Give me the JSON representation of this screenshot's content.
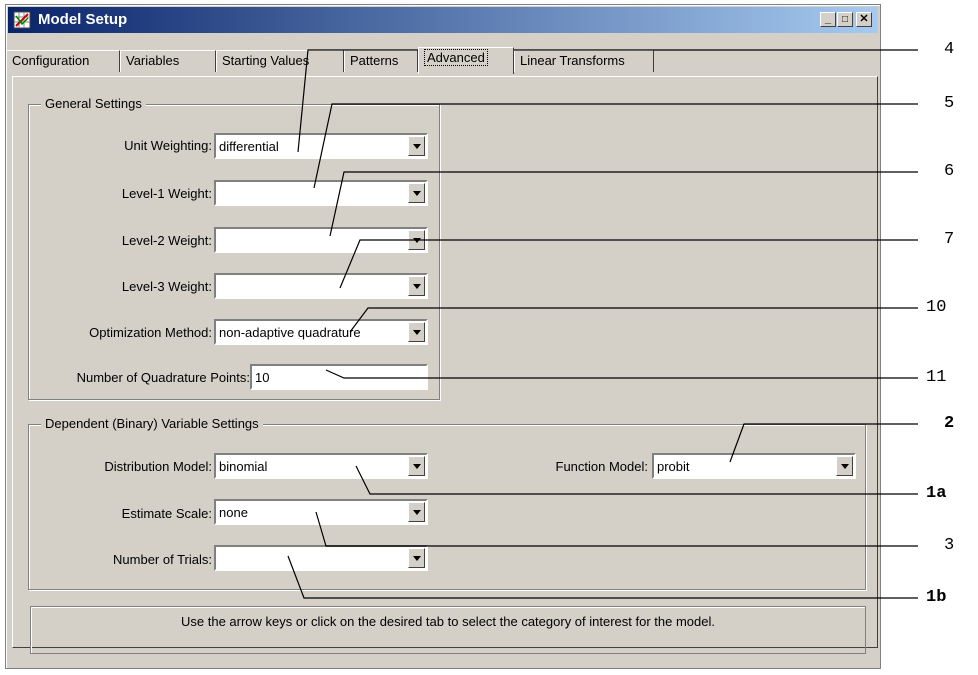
{
  "window": {
    "title": "Model Setup",
    "min": "_",
    "max": "□",
    "close": "✕"
  },
  "tabs": [
    {
      "label": "Configuration",
      "active": false
    },
    {
      "label": "Variables",
      "active": false
    },
    {
      "label": "Starting Values",
      "active": false
    },
    {
      "label": "Patterns",
      "active": false
    },
    {
      "label": "Advanced",
      "active": true
    },
    {
      "label": "Linear Transforms",
      "active": false
    }
  ],
  "general": {
    "title": "General Settings",
    "unit_weighting_label": "Unit Weighting:",
    "unit_weighting_value": "differential",
    "level1_label": "Level-1 Weight:",
    "level1_value": "",
    "level2_label": "Level-2 Weight:",
    "level2_value": "",
    "level3_label": "Level-3 Weight:",
    "level3_value": "",
    "optimization_label": "Optimization Method:",
    "optimization_value": "non-adaptive quadrature",
    "quad_points_label": "Number of Quadrature Points:",
    "quad_points_value": "10"
  },
  "dependent": {
    "title": "Dependent (Binary) Variable Settings",
    "distribution_label": "Distribution Model:",
    "distribution_value": "binomial",
    "function_label": "Function Model:",
    "function_value": "probit",
    "estimate_scale_label": "Estimate Scale:",
    "estimate_scale_value": "none",
    "num_trials_label": "Number of Trials:",
    "num_trials_value": ""
  },
  "status": "Use the arrow keys or click on the desired tab to select the category of interest for the model.",
  "callouts": [
    "4",
    "5",
    "6",
    "7",
    "10",
    "11",
    "2",
    "1a",
    "3",
    "1b"
  ]
}
